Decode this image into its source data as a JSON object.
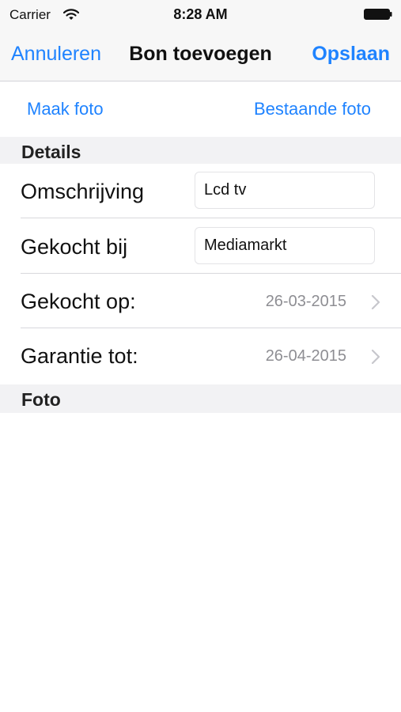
{
  "status_bar": {
    "carrier": "Carrier",
    "time": "8:28 AM",
    "icons": [
      "wifi-icon",
      "battery-icon"
    ]
  },
  "nav": {
    "cancel": "Annuleren",
    "title": "Bon toevoegen",
    "save": "Opslaan"
  },
  "photo_actions": {
    "take_photo": "Maak foto",
    "existing_photo": "Bestaande foto"
  },
  "sections": {
    "details": "Details",
    "photo": "Foto"
  },
  "fields": {
    "description": {
      "label": "Omschrijving",
      "value": "Lcd tv"
    },
    "store": {
      "label": "Gekocht bij",
      "value": "Mediamarkt"
    },
    "purchase_date": {
      "label": "Gekocht op:",
      "value": "26-03-2015"
    },
    "warranty_until": {
      "label": "Garantie tot:",
      "value": "26-04-2015"
    }
  },
  "colors": {
    "accent": "#1f83ff",
    "bar_background": "#f7f7f7",
    "section_background": "#f2f2f4",
    "secondary_text": "#8e8e93"
  }
}
